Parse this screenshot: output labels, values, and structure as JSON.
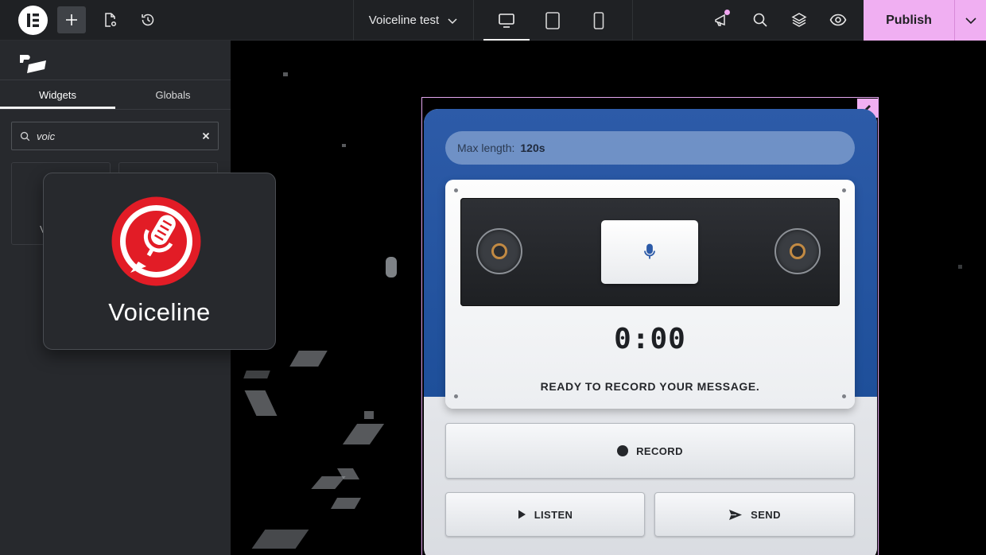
{
  "topbar": {
    "document_title": "Voiceline test",
    "publish_label": "Publish",
    "colors": {
      "bar": "#1f2124",
      "publish": "#f0aff2"
    },
    "icons": [
      "elementor-logo-icon",
      "plus-icon",
      "page-settings-icon",
      "history-icon",
      "chevron-down-icon",
      "desktop-icon",
      "tablet-icon",
      "mobile-icon",
      "announcement-icon",
      "search-icon",
      "layers-icon",
      "eye-icon"
    ]
  },
  "panel": {
    "tabs": [
      {
        "label": "Widgets",
        "active": true
      },
      {
        "label": "Globals",
        "active": false
      }
    ],
    "search": {
      "value": "voic"
    },
    "ghost_letter": "V",
    "drag_card": {
      "label": "Voiceline",
      "icon": "voiceline-mic-icon"
    },
    "brand_logo": "pro-radio-logo"
  },
  "widget": {
    "max_length_label": "Max length:",
    "max_length_value": "120s",
    "timer": "0:00",
    "status": "READY TO RECORD YOUR MESSAGE.",
    "record_label": "RECORD",
    "listen_label": "LISTEN",
    "send_label": "SEND",
    "colors": {
      "top": "#2d5ba8",
      "frame": "#e3a6ef",
      "reel_ring": "#c28a43",
      "mic": "#2d5ba8"
    }
  }
}
